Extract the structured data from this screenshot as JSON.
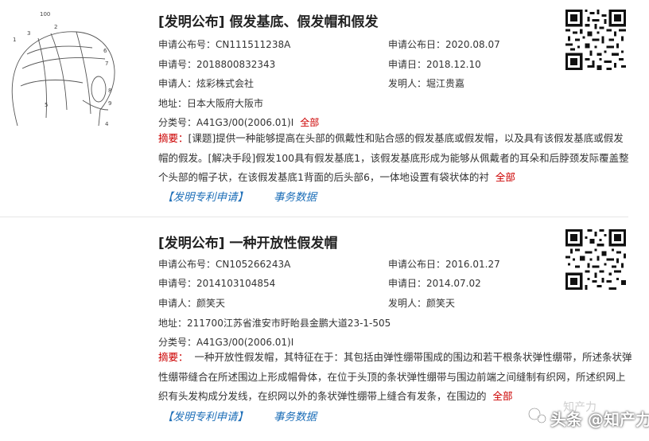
{
  "records": [
    {
      "title": "[发明公布] 假发基底、假发帽和假发",
      "pub_no_label": "申请公布号：",
      "pub_no": "CN111511238A",
      "pub_date_label": "申请公布日：",
      "pub_date": "2020.08.07",
      "app_no_label": "申请号：",
      "app_no": "2018800832343",
      "app_date_label": "申请日：",
      "app_date": "2018.12.10",
      "applicant_label": "申请人：",
      "applicant": "炫彩株式会社",
      "inventor_label": "发明人：",
      "inventor": "堀江贵嘉",
      "address_label": "地址：",
      "address": "日本大阪府大阪市",
      "class_label": "分类号：",
      "class": "A41G3/00(2006.01)I",
      "class_more": "全部",
      "abstract_label": "摘要：",
      "abstract": "[课题]提供一种能够提高在头部的佩戴性和贴合感的假发基底或假发帽，以及具有该假发基底或假发帽的假发。[解决手段]假发100具有假发基底1，该假发基底形成为能够从佩戴者的耳朵和后脖颈发际覆盖整个头部的帽子状，在该假发基底1背面的后头部6，一体地设置有袋状体的衬",
      "abstract_more": "全部",
      "link_patent": "【发明专利申请】",
      "link_affairs": "事务数据",
      "figure_labels": [
        "100",
        "1",
        "3",
        "2",
        "6",
        "7",
        "8",
        "9",
        "5",
        "4"
      ]
    },
    {
      "title": "[发明公布] 一种开放性假发帽",
      "pub_no_label": "申请公布号：",
      "pub_no": "CN105266243A",
      "pub_date_label": "申请公布日：",
      "pub_date": "2016.01.27",
      "app_no_label": "申请号：",
      "app_no": "2014103104854",
      "app_date_label": "申请日：",
      "app_date": "2014.07.02",
      "applicant_label": "申请人：",
      "applicant": "颜笑天",
      "inventor_label": "发明人：",
      "inventor": "颜笑天",
      "address_label": "地址：",
      "address": "211700江苏省淮安市盱眙县金鹏大道23-1-505",
      "class_label": "分类号：",
      "class": "A41G3/00(2006.01)I",
      "abstract_label": "摘要：",
      "abstract": "一种开放性假发帽，其特征在于：其包括由弹性绷带围成的围边和若干根条状弹性绷带，所述条状弹性绷带缝合在所述围边上形成帽骨体，在位于头顶的条状弹性绷带与围边前端之间缝制有织网，所述织网上织有头发构成分发线，在织网以外的条状弹性绷带上缝合有发条，在围边的",
      "abstract_more": "全部",
      "link_patent": "【发明专利申请】",
      "link_affairs": "事务数据"
    }
  ],
  "watermark": {
    "text": "头条 @知产力",
    "brand": "知产力"
  },
  "colors": {
    "accent_red": "#cc0000",
    "link_blue": "#1e6fb8"
  }
}
